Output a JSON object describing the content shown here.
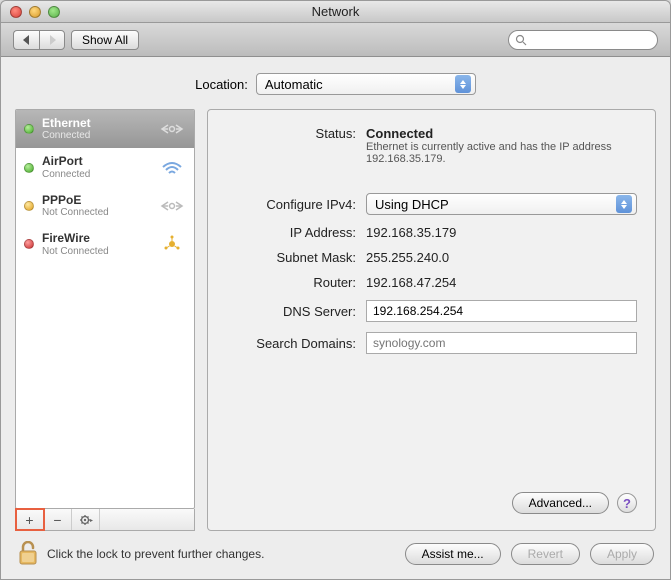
{
  "window": {
    "title": "Network"
  },
  "toolbar": {
    "show_all": "Show All"
  },
  "search": {
    "placeholder": ""
  },
  "location": {
    "label": "Location:",
    "value": "Automatic"
  },
  "sidebar": {
    "items": [
      {
        "name": "Ethernet",
        "status": "Connected",
        "dot": "green",
        "icon": "ethernet-icon",
        "selected": true
      },
      {
        "name": "AirPort",
        "status": "Connected",
        "dot": "green",
        "icon": "wifi-icon",
        "selected": false
      },
      {
        "name": "PPPoE",
        "status": "Not Connected",
        "dot": "yellow",
        "icon": "ethernet-icon",
        "selected": false
      },
      {
        "name": "FireWire",
        "status": "Not Connected",
        "dot": "red",
        "icon": "firewire-icon",
        "selected": false
      }
    ],
    "add_label": "+",
    "remove_label": "−",
    "gear_label": "gear"
  },
  "details": {
    "status_label": "Status:",
    "status_value": "Connected",
    "status_desc": "Ethernet is currently active and has the IP address 192.168.35.179.",
    "configure_label": "Configure IPv4:",
    "configure_value": "Using DHCP",
    "ip_label": "IP Address:",
    "ip_value": "192.168.35.179",
    "subnet_label": "Subnet Mask:",
    "subnet_value": "255.255.240.0",
    "router_label": "Router:",
    "router_value": "192.168.47.254",
    "dns_label": "DNS Server:",
    "dns_value": "192.168.254.254",
    "search_label": "Search Domains:",
    "search_placeholder": "synology.com",
    "advanced_label": "Advanced..."
  },
  "footer": {
    "lock_text": "Click the lock to prevent further changes.",
    "assist": "Assist me...",
    "revert": "Revert",
    "apply": "Apply"
  }
}
